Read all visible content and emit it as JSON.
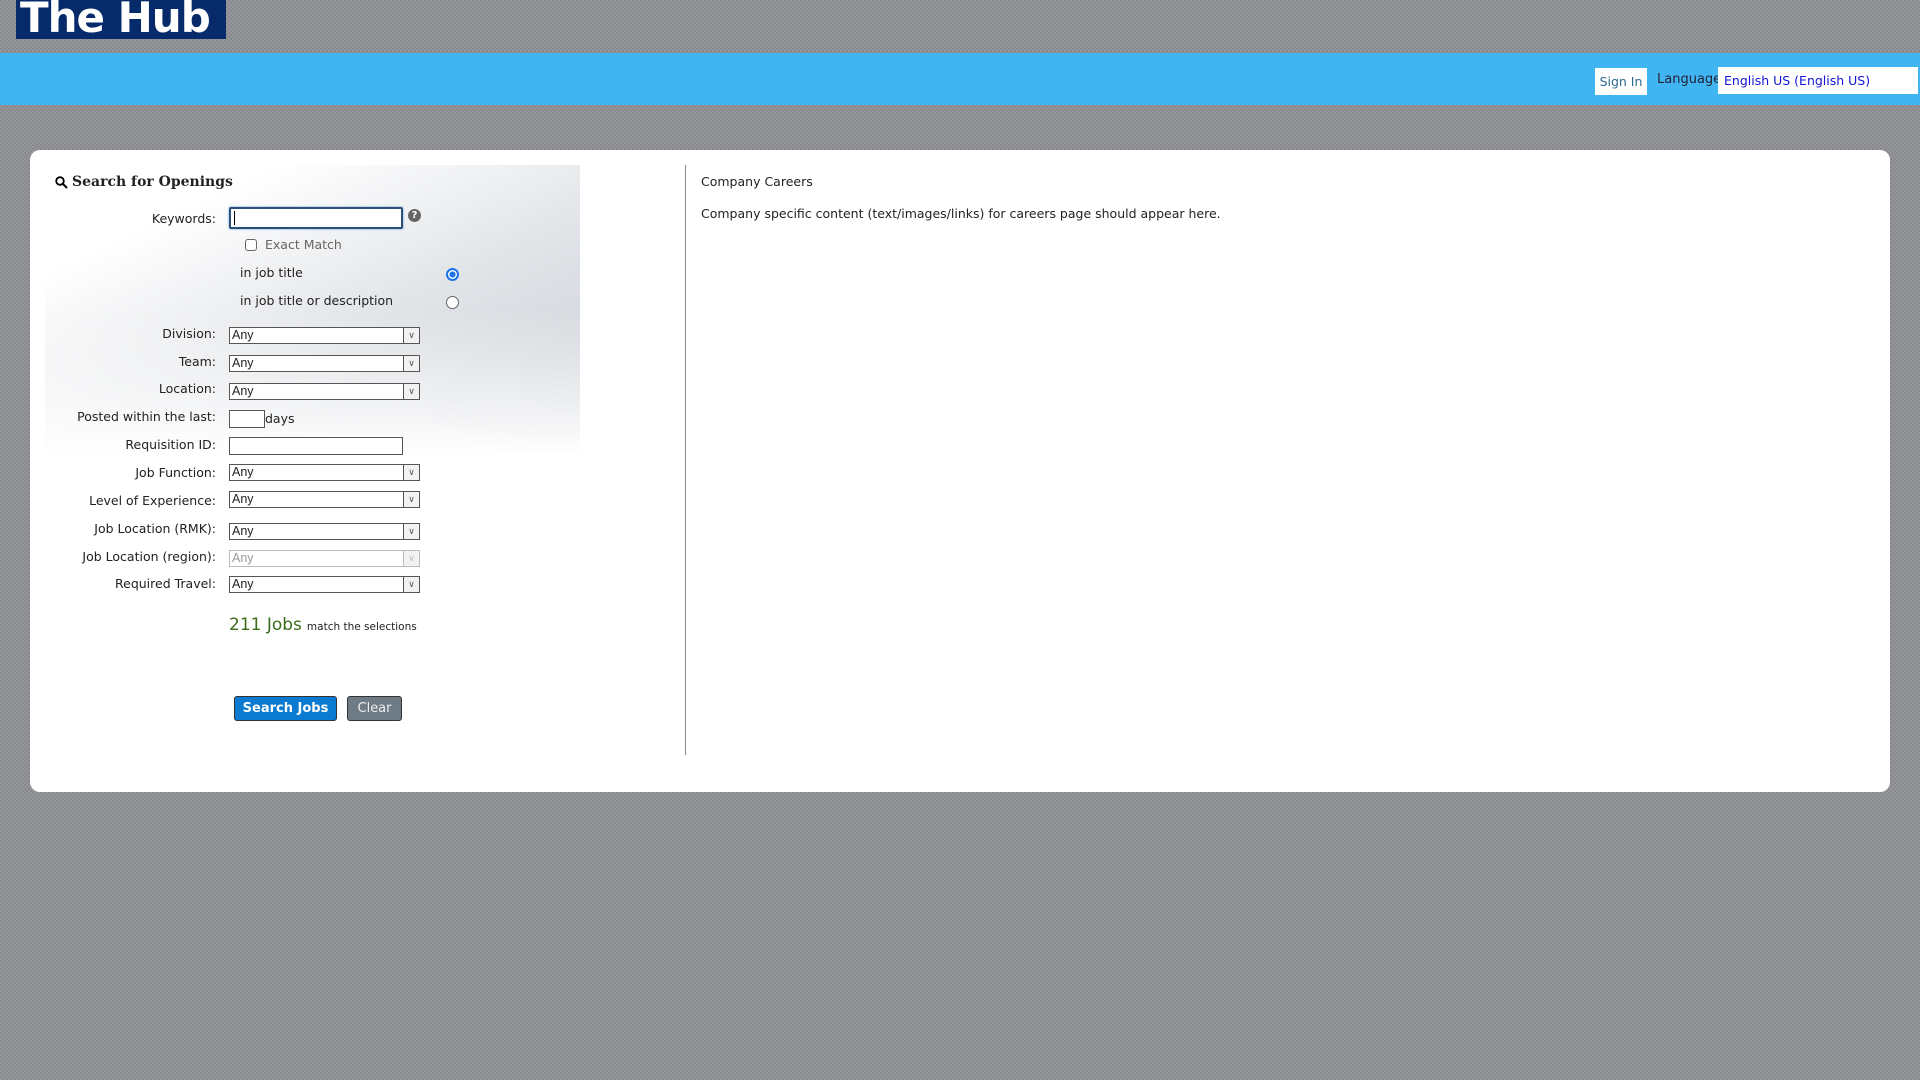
{
  "header": {
    "logo_text": "The Hub",
    "sign_in": "Sign In",
    "language_label": "Language",
    "language_value": "English US (English US)"
  },
  "search": {
    "title": "Search for Openings",
    "keywords_label": "Keywords:",
    "keywords_value": "",
    "exact_match": "Exact Match",
    "radio_title": "in job title",
    "radio_title_desc": "in job title or description",
    "fields": [
      {
        "label": "Division:",
        "value": "Any"
      },
      {
        "label": "Team:",
        "value": "Any"
      },
      {
        "label": "Location:",
        "value": "Any"
      },
      {
        "label": "Posted within the last:",
        "unit": "days"
      },
      {
        "label": "Requisition ID:"
      },
      {
        "label": "Job Function:",
        "value": "Any"
      },
      {
        "label": "Level of Experience:",
        "value": "Any"
      },
      {
        "label": "Job Location (RMK):",
        "value": "Any"
      },
      {
        "label": "Job Location (region):",
        "value": "Any"
      },
      {
        "label": "Required Travel:",
        "value": "Any"
      }
    ],
    "job_count": "211 Jobs",
    "match_text": "match the selections",
    "search_button": "Search Jobs",
    "clear_button": "Clear"
  },
  "content": {
    "title": "Company Careers",
    "body": "Company specific content (text/images/links) for careers page should appear here."
  }
}
